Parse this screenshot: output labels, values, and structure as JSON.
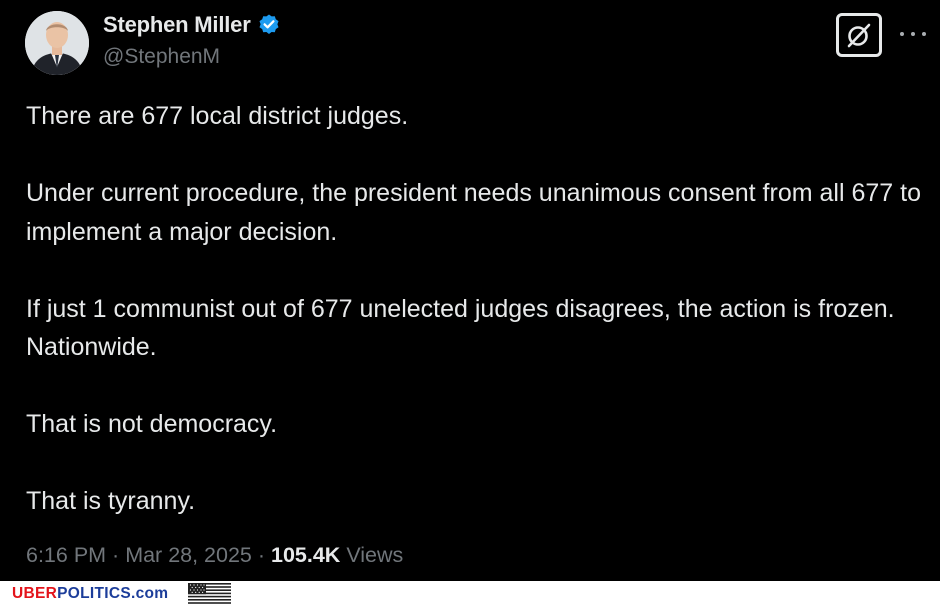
{
  "author": {
    "display_name": "Stephen Miller",
    "handle": "@StephenM",
    "verified": true,
    "verified_icon": "verified-badge-icon",
    "verified_color": "#1d9bf0"
  },
  "actions": {
    "grok_icon": "grok-icon",
    "more_icon": "more-horizontal-icon"
  },
  "tweet": {
    "paragraphs": [
      "There are 677 local district judges.",
      "Under current procedure, the president needs unanimous consent from all 677 to implement a major decision.",
      "If just 1 communist out of 677 unelected judges disagrees, the action is frozen. Nationwide.",
      "That is not democracy.",
      "That is tyranny."
    ]
  },
  "meta": {
    "time": "6:16 PM",
    "separator": " · ",
    "date": "Mar 28, 2025",
    "views_count": "105.4K",
    "views_label": "Views"
  },
  "footer": {
    "brand_part1": "UBER",
    "brand_part2": "POLITICS.com",
    "brand_color_1": "#e3141b",
    "brand_color_2": "#1c3d9a",
    "flag_icon": "us-flag-icon"
  }
}
